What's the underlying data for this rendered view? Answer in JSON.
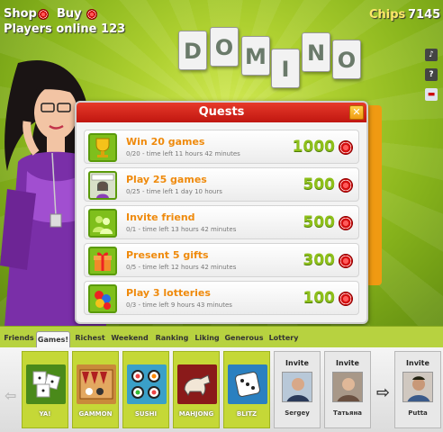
{
  "topbar": {
    "shop_label": "Shop",
    "buy_label": "Buy",
    "players_online": "Players online 123",
    "chips_label": "Chips",
    "chips_value": "7145"
  },
  "logo": {
    "letters": [
      "D",
      "O",
      "M",
      "I",
      "N",
      "O"
    ]
  },
  "side_icons": [
    "speaker-icon",
    "help-icon",
    "flag-icon"
  ],
  "modal": {
    "title": "Quests",
    "close_label": "✕",
    "quests": [
      {
        "title": "Win 20 games",
        "subtitle": "0/20 - time left 11 hours 42 minutes",
        "reward": "1000",
        "icon": "trophy-icon"
      },
      {
        "title": "Play 25 games",
        "subtitle": "0/25 - time left 1 day 10 hours",
        "reward": "500",
        "icon": "domino-girl-icon"
      },
      {
        "title": "Invite friend",
        "subtitle": "0/1 - time left 13 hours 42 minutes",
        "reward": "500",
        "icon": "friends-icon"
      },
      {
        "title": "Present 5 gifts",
        "subtitle": "0/5 - time left 12 hours 42 minutes",
        "reward": "300",
        "icon": "gift-icon"
      },
      {
        "title": "Play 3 lotteries",
        "subtitle": "0/3 - time left 9 hours 43 minutes",
        "reward": "100",
        "icon": "lottery-icon"
      }
    ]
  },
  "tabs": [
    {
      "label": "Friends",
      "active": false
    },
    {
      "label": "Games!",
      "active": true
    },
    {
      "label": "Richest",
      "active": false
    },
    {
      "label": "Weekend",
      "active": false
    },
    {
      "label": "Ranking",
      "active": false
    },
    {
      "label": "Liking",
      "active": false
    },
    {
      "label": "Generous",
      "active": false
    },
    {
      "label": "Lottery",
      "active": false
    }
  ],
  "games": [
    {
      "label": "YA!",
      "icon": "dice-flower-icon"
    },
    {
      "label": "GAMMON",
      "icon": "backgammon-icon"
    },
    {
      "label": "SUSHI",
      "icon": "sushi-icon"
    },
    {
      "label": "MAHJONG",
      "icon": "mahjong-icon"
    },
    {
      "label": "BLITZ",
      "icon": "dice-icon"
    }
  ],
  "invites": [
    {
      "label": "Invite",
      "name": "Sergey"
    },
    {
      "label": "Invite",
      "name": "Татьяна"
    },
    {
      "label": "Invite",
      "name": "Putta"
    }
  ],
  "colors": {
    "accent_orange": "#ef8a0c",
    "reward_green": "#8ec01a",
    "header_red": "#d42418",
    "background_green": "#9cc226"
  }
}
